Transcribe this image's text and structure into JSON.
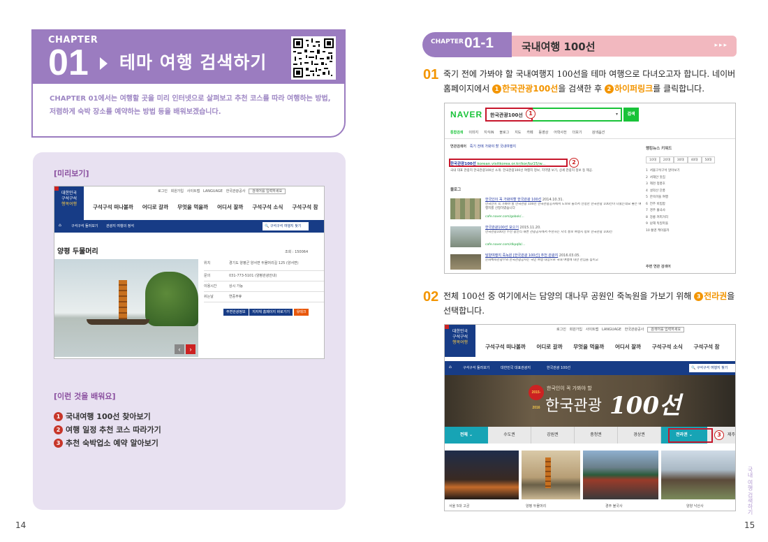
{
  "left_page": {
    "chapter_label": "CHAPTER",
    "chapter_number": "01",
    "chapter_title": "테마 여행 검색하기",
    "chapter_desc_line1": "CHAPTER 01에서는 여행할 곳을 미리 인터넷으로 살펴보고 추천 코스를 따라 여행하는 방법,",
    "chapter_desc_line2": "저렴하게 숙박 장소를 예약하는 방법 등을 배워보겠습니다.",
    "preview_label": "[미리보기]",
    "learn_label": "[이런 것을 배워요]",
    "learn_items": [
      {
        "num": "1",
        "text": "국내여행 100선 찾아보기"
      },
      {
        "num": "2",
        "text": "여행 일정 추천 코스 따라가기"
      },
      {
        "num": "3",
        "text": "추천 숙박업소 예약 알아보기"
      }
    ],
    "page_number": "14",
    "preview_site": {
      "logo_lines": [
        "대한민국",
        "구석구석",
        "행복여행"
      ],
      "top_links": [
        "로그인",
        "회원가입",
        "사이트맵",
        "LANGUAGE",
        "한국관광공사",
        "검색어를 입력하세요"
      ],
      "menu": [
        "구석구석 떠나볼까",
        "어디로 갈까",
        "무엇을 먹을까",
        "어디서 잘까",
        "구석구석 소식",
        "구석구석 참"
      ],
      "breadcrumb": [
        "구석구석 둘러보기",
        "관광지 여행의 정석"
      ],
      "search_label": "구석구석 여행지 찾기",
      "place_title": "양평 두물머리",
      "views": "조회 : 150064",
      "info_rows": [
        {
          "label": "위치",
          "value": "경기도 양평군 양서면 두물머리길 125 (양서면)"
        },
        {
          "label": "문의",
          "value": "031-773-5101 (양평관광안내)"
        },
        {
          "label": "이용시간",
          "value": "상시 가능"
        },
        {
          "label": "쉬는날",
          "value": "연중무휴"
        }
      ],
      "buttons": [
        "주변관광정보",
        "지자체 홈페이지 바로가기",
        "유테크"
      ]
    }
  },
  "right_page": {
    "chapter_label": "CHAPTER",
    "chapter_number": "01-1",
    "section_title": "국내여행 100선",
    "dots": "▸▸▸",
    "step1_num": "01",
    "step1_line1": "죽기 전에 가봐야 할 국내여행지 100선을 테마 여행으로 다녀오고자 합니다. 네이버",
    "step1_line2_pre": "홈페이지에서 ",
    "step1_c1": "1",
    "step1_hl1": "한국관광100선",
    "step1_mid": "을 검색한 후 ",
    "step1_c2": "2",
    "step1_hl2": "하이퍼링크",
    "step1_end": "를 클릭합니다.",
    "step2_num": "02",
    "step2_line1_pre": "전체 100선 중 여기에서는 담양의 대나무 공원인 죽녹원을 가보기 위해 ",
    "step2_c3": "3",
    "step2_hl3": "전라권",
    "step2_line1_end": "을",
    "step2_line2": "선택합니다.",
    "page_number": "15",
    "side_label": "국내 여행 검색하기",
    "naver": {
      "logo": "NAVER",
      "query": "한국관광100선",
      "search_btn": "검색",
      "tabs": [
        "통합검색",
        "이미지",
        "지식iN",
        "블로그",
        "지도",
        "카페",
        "동영상",
        "어학사전",
        "더보기",
        "검색옵션"
      ],
      "related_label": "연관검색어",
      "related": "죽기 전에 가봐야 할 국내여행지",
      "site_link": "한국관광100선",
      "site_url": "korean.visitkorea.or.kr/kor/bz15/w...",
      "site_desc": "국내 대표 관광지 한국관광100선 소개. 한국관광100선 여행지 정보, 지역별 보기, 상세 관광지 정보 등 제공.",
      "blog_label": "블로그",
      "results": [
        {
          "title": "한국인이 꼭 가봐야할 한국관광 100선",
          "date": "2014.10.31.",
          "text": "한국인이 꼭 가봐야 할 한국관광 100선 한국관광공사에서 도보로 둘러서 선정한 한국관광 100선이 나왔는데요 좋은 여행지를 선정하였습니다",
          "src": "cafe.naver.com/gobok/..."
        },
        {
          "title": "한국관광100선 모으기",
          "date": "2015.11.20.",
          "text": "한국관광100선 부산 광안리 해변 관광공사에서 추천하는 지역 홍보 여행지 정보 한국관광 100선",
          "src": "cafe.naver.com/dkpqlb/..."
        },
        {
          "title": "담양여행지 죽녹원 [한국관광 100선] 추천 관광지",
          "date": "2016.03.05.",
          "text": "문화체육관광부와 한국관광공사는 국민 여행 대상으로 국내 여행에 대한 관심을 높이고",
          "src": ""
        }
      ],
      "sidebar_title": "랭킹뉴스 키워드",
      "sidebar_tabs": [
        "10대",
        "20대",
        "30대",
        "40대",
        "50대"
      ],
      "sidebar_items": [
        "서울구석구석 알아보기",
        "서해안 맛집",
        "제천 청풍호",
        "설악산 단풍",
        "한옥마을 여행",
        "전주 비빔밥",
        "경주 불국사",
        "강릉 커피거리",
        "남해 독일마을",
        "통영 케이블카"
      ],
      "sidebar_bottom": "주변 연관 검색어"
    },
    "site2": {
      "logo_lines": [
        "대한민국",
        "구석구석",
        "행복여행"
      ],
      "top_links": [
        "로그인",
        "회원가입",
        "사이트맵",
        "LANGUAGE",
        "한국관광공사",
        "검색어를 입력하세요"
      ],
      "menu": [
        "구석구석 떠나볼까",
        "어디로 갈까",
        "무엇을 먹을까",
        "어디서 잘까",
        "구석구석 소식",
        "구석구석 참"
      ],
      "breadcrumb": [
        "구석구석 둘러보기",
        "대한민국 대표관광지",
        "한국관광 100선"
      ],
      "search_label": "구석구석 여행지 찾기",
      "hero_small": "한국인이 꼭 가봐야 할",
      "hero_big": "한국관광",
      "hero_num": "100선",
      "hero_badge": "2015-2016",
      "regions": [
        "전체",
        "수도권",
        "강원권",
        "충청권",
        "경상권",
        "전라권",
        "제주"
      ],
      "photos": [
        "서울 5대 고궁",
        "양평 두물머리",
        "",
        "경주 불국사",
        "양양 낙산사"
      ]
    }
  }
}
